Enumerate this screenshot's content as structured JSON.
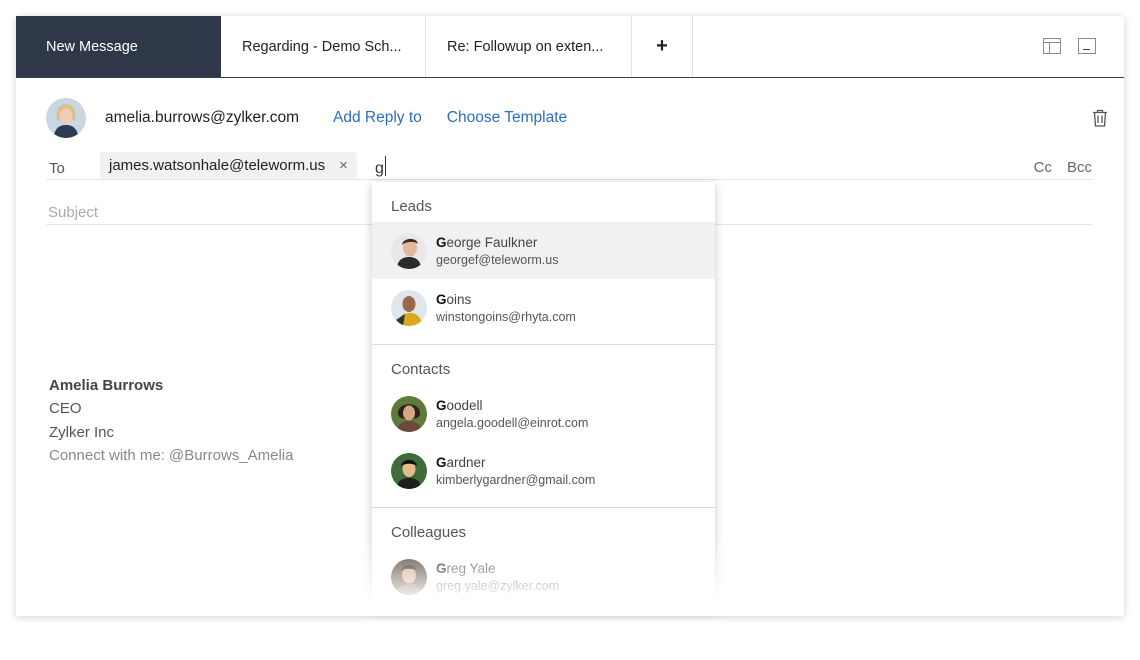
{
  "tabs": [
    {
      "label": "New Message",
      "active": true
    },
    {
      "label": "Regarding - Demo Sch..."
    },
    {
      "label": "Re: Followup on exten..."
    },
    {
      "label": "+"
    }
  ],
  "window_controls": {
    "restore_icon": "restore-window-icon",
    "minimize_icon": "minimize-window-icon"
  },
  "from": {
    "email": "amelia.burrows@zylker.com",
    "add_reply_to": "Add Reply to",
    "choose_template": "Choose Template"
  },
  "to": {
    "label": "To",
    "recipient": "james.watsonhale@teleworm.us",
    "remove": "×",
    "typed": "g",
    "cc": "Cc",
    "bcc": "Bcc"
  },
  "subject": {
    "placeholder": "Subject"
  },
  "signature": {
    "name": "Amelia Burrows",
    "title": "CEO",
    "company": "Zylker Inc",
    "connect": "Connect with me: @Burrows_Amelia"
  },
  "suggestions": {
    "leads": {
      "title": "Leads",
      "items": [
        {
          "match": "G",
          "rest": "eorge Faulkner",
          "email": "georgef@teleworm.us"
        },
        {
          "match": "G",
          "rest": "oins",
          "email": "winstongoins@rhyta.com"
        }
      ]
    },
    "contacts": {
      "title": "Contacts",
      "items": [
        {
          "match": "G",
          "rest": "oodell",
          "email": "angela.goodell@einrot.com"
        },
        {
          "match": "G",
          "rest": "ardner",
          "email": "kimberlygardner@gmail.com"
        }
      ]
    },
    "colleagues": {
      "title": "Colleagues",
      "items": [
        {
          "match": "G",
          "rest": "reg Yale",
          "email": "greg.yale@zylker.com"
        }
      ]
    }
  },
  "colors": {
    "tab_active": "#2f3849",
    "link": "#2a6dc4",
    "highlight": "#f1f1f1"
  }
}
